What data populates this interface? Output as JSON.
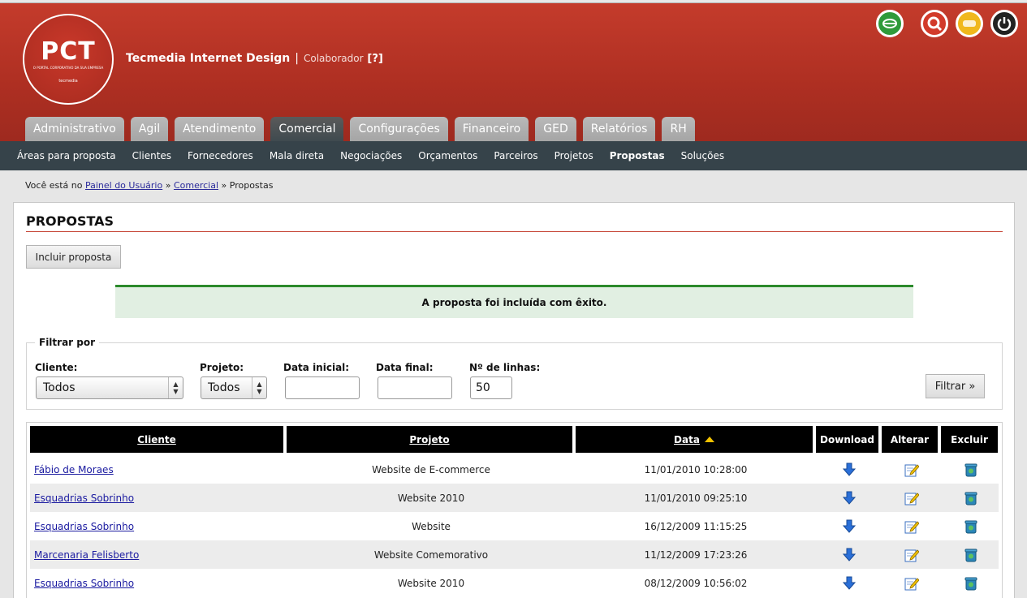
{
  "header": {
    "logo_text": "PCT",
    "logo_tagline": "O PORTAL CORPORATIVO DA SUA EMPRESA",
    "logo_brand": "tecmedia",
    "company": "Tecmedia Internet Design",
    "separator": "|",
    "role": "Colaborador",
    "help": "[?]"
  },
  "main_tabs": [
    "Administrativo",
    "Agil",
    "Atendimento",
    "Comercial",
    "Configurações",
    "Financeiro",
    "GED",
    "Relatórios",
    "RH"
  ],
  "active_tab": "Comercial",
  "subnav": [
    "Áreas para proposta",
    "Clientes",
    "Fornecedores",
    "Mala direta",
    "Negociações",
    "Orçamentos",
    "Parceiros",
    "Projetos",
    "Propostas",
    "Soluções"
  ],
  "active_subnav": "Propostas",
  "breadcrumb": {
    "prefix": "Você está no",
    "items": [
      "Painel do Usuário",
      "Comercial"
    ],
    "sep": "»",
    "current": "Propostas"
  },
  "page": {
    "title": "PROPOSTAS",
    "add_button": "Incluir proposta",
    "success_message": "A proposta foi incluída com êxito."
  },
  "filter": {
    "legend": "Filtrar por",
    "cliente_label": "Cliente:",
    "cliente_value": "Todos",
    "projeto_label": "Projeto:",
    "projeto_value": "Todos",
    "data_inicial_label": "Data inicial:",
    "data_inicial_value": "",
    "data_final_label": "Data final:",
    "data_final_value": "",
    "linhas_label": "Nº de linhas:",
    "linhas_value": "50",
    "submit": "Filtrar »"
  },
  "table": {
    "columns": [
      "Cliente",
      "Projeto",
      "Data",
      "Download",
      "Alterar",
      "Excluir"
    ],
    "sorted_column": "Data",
    "rows": [
      {
        "cliente": "Fábio de Moraes",
        "projeto": "Website de E-commerce",
        "data": "11/01/2010 10:28:00"
      },
      {
        "cliente": "Esquadrias Sobrinho",
        "projeto": "Website 2010",
        "data": "11/01/2010 09:25:10"
      },
      {
        "cliente": "Esquadrias Sobrinho",
        "projeto": "Website",
        "data": "16/12/2009 11:15:25"
      },
      {
        "cliente": "Marcenaria Felisberto",
        "projeto": "Website Comemorativo",
        "data": "11/12/2009 17:23:26"
      },
      {
        "cliente": "Esquadrias Sobrinho",
        "projeto": "Website 2010",
        "data": "08/12/2009 10:56:02"
      }
    ]
  },
  "colors": {
    "header_red": "#b3342a",
    "subnav_bg": "#36434a",
    "success_border": "#2c8a2c",
    "success_bg": "#e1efe2",
    "link": "#1a1aa0"
  }
}
